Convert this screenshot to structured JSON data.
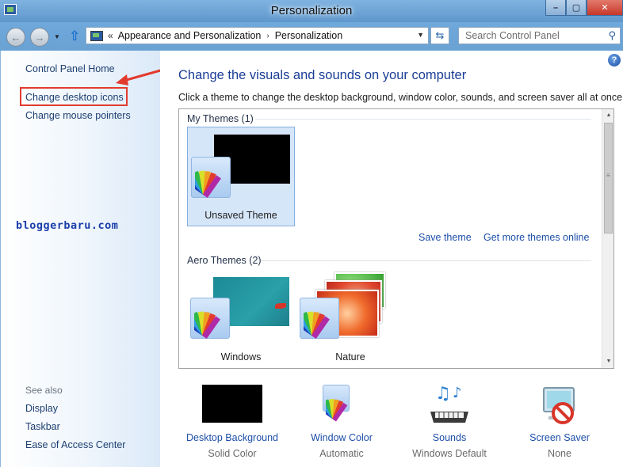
{
  "window": {
    "title": "Personalization",
    "minimize_glyph": "–",
    "maximize_glyph": "▢",
    "close_glyph": "✕"
  },
  "address_bar": {
    "root_separator": "«",
    "breadcrumbs": [
      "Appearance and Personalization",
      "Personalization"
    ],
    "separator_glyph": "›"
  },
  "search": {
    "placeholder": "Search Control Panel"
  },
  "sidebar": {
    "home_link": "Control Panel Home",
    "links": [
      "Change desktop icons",
      "Change mouse pointers"
    ],
    "watermark": "bloggerbaru.com",
    "see_also_label": "See also",
    "see_also_links": [
      "Display",
      "Taskbar",
      "Ease of Access Center"
    ]
  },
  "main": {
    "help_glyph": "?",
    "heading": "Change the visuals and sounds on your computer",
    "description": "Click a theme to change the desktop background, window color, sounds, and screen saver all at once.",
    "groups": [
      {
        "header": "My Themes (1)",
        "themes": [
          {
            "label": "Unsaved Theme",
            "selected": true
          }
        ]
      },
      {
        "header": "Aero Themes (2)",
        "themes": [
          {
            "label": "Windows",
            "selected": false
          },
          {
            "label": "Nature",
            "selected": false
          }
        ]
      }
    ],
    "save_theme_link": "Save theme",
    "more_themes_link": "Get more themes online"
  },
  "settings": [
    {
      "title": "Desktop Background",
      "value": "Solid Color"
    },
    {
      "title": "Window Color",
      "value": "Automatic"
    },
    {
      "title": "Sounds",
      "value": "Windows Default"
    },
    {
      "title": "Screen Saver",
      "value": "None"
    }
  ],
  "colors": {
    "link": "#1d4fa8",
    "heading": "#1a3d96",
    "annotation_red": "#e23b2e",
    "selection": "#d6e6f9"
  }
}
